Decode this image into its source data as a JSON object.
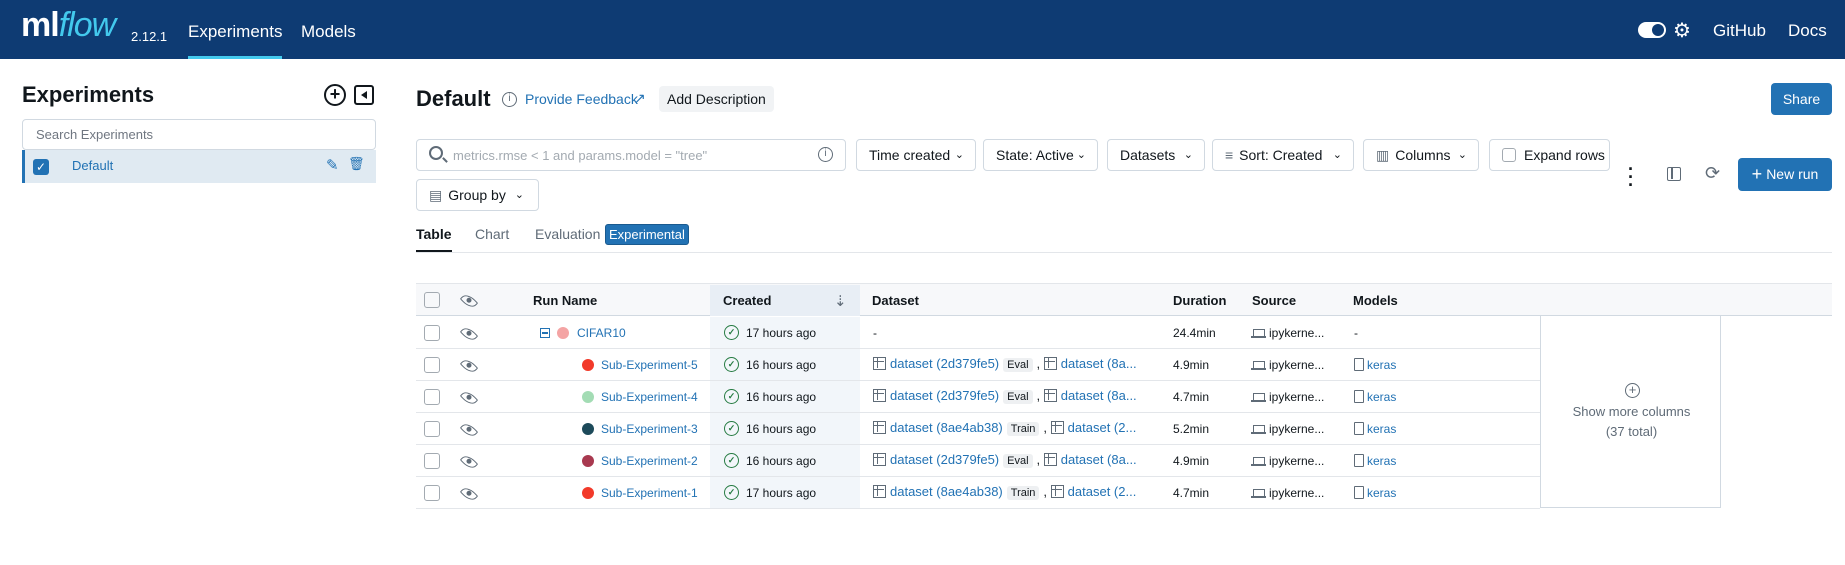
{
  "app": {
    "logo_ml": "ml",
    "logo_flow": "flow",
    "version": "2.12.1"
  },
  "topnav": {
    "experiments": "Experiments",
    "models": "Models",
    "github": "GitHub",
    "docs": "Docs"
  },
  "sidebar": {
    "title": "Experiments",
    "search_placeholder": "Search Experiments",
    "experiments": [
      {
        "name": "Default",
        "checked": true
      }
    ]
  },
  "header": {
    "title": "Default",
    "feedback": "Provide Feedback",
    "add_description": "Add Description",
    "share": "Share"
  },
  "toolbar": {
    "filter_placeholder": "metrics.rmse < 1 and params.model = \"tree\"",
    "time_created": "Time created",
    "state": "State: Active",
    "datasets": "Datasets",
    "sort": "Sort: Created",
    "columns": "Columns",
    "expand_rows": "Expand rows",
    "group_by": "Group by",
    "new_run": "New run"
  },
  "tabs": {
    "table": "Table",
    "chart": "Chart",
    "evaluation": "Evaluation",
    "experimental": "Experimental"
  },
  "table": {
    "headers": {
      "run_name": "Run Name",
      "created": "Created",
      "dataset": "Dataset",
      "duration": "Duration",
      "source": "Source",
      "models": "Models"
    },
    "rows": [
      {
        "name": "CIFAR10",
        "color": "#f4a4a4",
        "created": "17 hours ago",
        "dataset": "-",
        "dataset2": "",
        "tag": "",
        "duration": "24.4min",
        "source": "ipykerne...",
        "model": "-",
        "parent": true
      },
      {
        "name": "Sub-Experiment-5",
        "color": "#f23a2a",
        "created": "16 hours ago",
        "dataset": "dataset (2d379fe5)",
        "tag": "Eval",
        "dataset2": "dataset (8a...",
        "duration": "4.9min",
        "source": "ipykerne...",
        "model": "keras"
      },
      {
        "name": "Sub-Experiment-4",
        "color": "#a3dcb4",
        "created": "16 hours ago",
        "dataset": "dataset (2d379fe5)",
        "tag": "Eval",
        "dataset2": "dataset (8a...",
        "duration": "4.7min",
        "source": "ipykerne...",
        "model": "keras"
      },
      {
        "name": "Sub-Experiment-3",
        "color": "#1d4a5a",
        "created": "16 hours ago",
        "dataset": "dataset (8ae4ab38)",
        "tag": "Train",
        "dataset2": "dataset (2...",
        "duration": "5.2min",
        "source": "ipykerne...",
        "model": "keras"
      },
      {
        "name": "Sub-Experiment-2",
        "color": "#a8394f",
        "created": "16 hours ago",
        "dataset": "dataset (2d379fe5)",
        "tag": "Eval",
        "dataset2": "dataset (8a...",
        "duration": "4.9min",
        "source": "ipykerne...",
        "model": "keras"
      },
      {
        "name": "Sub-Experiment-1",
        "color": "#f23a2a",
        "created": "17 hours ago",
        "dataset": "dataset (8ae4ab38)",
        "tag": "Train",
        "dataset2": "dataset (2...",
        "duration": "4.7min",
        "source": "ipykerne...",
        "model": "keras"
      }
    ],
    "more_columns": "Show more columns",
    "more_total": "(37 total)"
  },
  "colors": {
    "nav_bg": "#0e3b73",
    "accent": "#2272b4",
    "flow": "#43c9ed"
  }
}
